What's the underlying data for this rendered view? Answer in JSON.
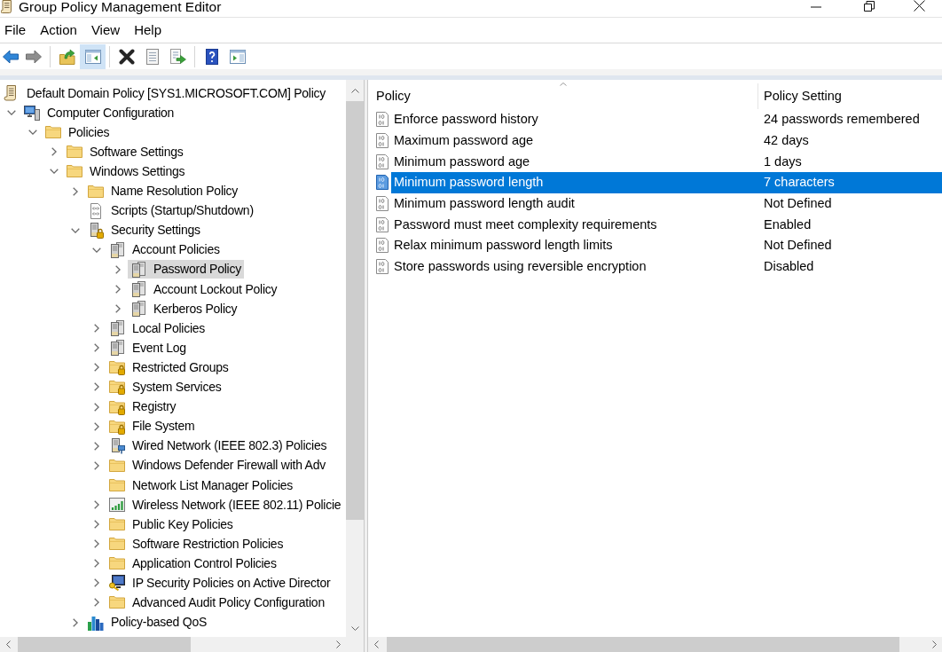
{
  "window": {
    "title": "Group Policy Management Editor"
  },
  "menu": [
    "File",
    "Action",
    "View",
    "Help"
  ],
  "toolbar": {
    "groups": [
      {
        "buttons": [
          {
            "kind": "back",
            "pressed": false,
            "disabled": false
          },
          {
            "kind": "forward",
            "pressed": false,
            "disabled": true
          }
        ]
      },
      {
        "buttons": [
          {
            "kind": "up",
            "pressed": false,
            "disabled": false
          },
          {
            "kind": "console_tree",
            "pressed": true,
            "disabled": false
          }
        ]
      },
      {
        "buttons": [
          {
            "kind": "delete",
            "pressed": false,
            "disabled": false
          },
          {
            "kind": "properties",
            "pressed": false,
            "disabled": false
          },
          {
            "kind": "export",
            "pressed": false,
            "disabled": false
          }
        ]
      },
      {
        "buttons": [
          {
            "kind": "help",
            "pressed": false,
            "disabled": false
          },
          {
            "kind": "action_pane",
            "pressed": false,
            "disabled": false
          }
        ]
      }
    ]
  },
  "tree": {
    "root": {
      "label": "Default Domain Policy [SYS1.MICROSOFT.COM] Policy",
      "kind": "policy",
      "selected": false,
      "children": [
        {
          "label": "Computer Configuration",
          "kind": "computer",
          "expandable": true,
          "expanded": true,
          "selected": false,
          "children": [
            {
              "label": "Policies",
              "kind": "folder",
              "expandable": true,
              "expanded": true,
              "selected": false,
              "children": [
                {
                  "label": "Software Settings",
                  "kind": "folder",
                  "expandable": true,
                  "expanded": false,
                  "selected": false
                },
                {
                  "label": "Windows Settings",
                  "kind": "folder",
                  "expandable": true,
                  "expanded": true,
                  "selected": false,
                  "children": [
                    {
                      "label": "Name Resolution Policy",
                      "kind": "folder",
                      "expandable": true,
                      "expanded": false,
                      "selected": false
                    },
                    {
                      "label": "Scripts (Startup/Shutdown)",
                      "kind": "script",
                      "expandable": false,
                      "selected": false
                    },
                    {
                      "label": "Security Settings",
                      "kind": "security",
                      "expandable": true,
                      "expanded": true,
                      "selected": false,
                      "children": [
                        {
                          "label": "Account Policies",
                          "kind": "server",
                          "expandable": true,
                          "expanded": true,
                          "selected": false,
                          "children": [
                            {
                              "label": "Password Policy",
                              "kind": "server",
                              "expandable": true,
                              "expanded": false,
                              "selected": true
                            },
                            {
                              "label": "Account Lockout Policy",
                              "kind": "server",
                              "expandable": true,
                              "expanded": false,
                              "selected": false
                            },
                            {
                              "label": "Kerberos Policy",
                              "kind": "server",
                              "expandable": true,
                              "expanded": false,
                              "selected": false
                            }
                          ]
                        },
                        {
                          "label": "Local Policies",
                          "kind": "server",
                          "expandable": true,
                          "expanded": false,
                          "selected": false
                        },
                        {
                          "label": "Event Log",
                          "kind": "server",
                          "expandable": true,
                          "expanded": false,
                          "selected": false
                        },
                        {
                          "label": "Restricted Groups",
                          "kind": "locked_folder",
                          "expandable": true,
                          "expanded": false,
                          "selected": false
                        },
                        {
                          "label": "System Services",
                          "kind": "locked_folder",
                          "expandable": true,
                          "expanded": false,
                          "selected": false
                        },
                        {
                          "label": "Registry",
                          "kind": "locked_folder",
                          "expandable": true,
                          "expanded": false,
                          "selected": false
                        },
                        {
                          "label": "File System",
                          "kind": "locked_folder",
                          "expandable": true,
                          "expanded": false,
                          "selected": false
                        },
                        {
                          "label": "Wired Network (IEEE 802.3) Policies",
                          "kind": "wired",
                          "expandable": true,
                          "expanded": false,
                          "selected": false
                        },
                        {
                          "label": "Windows Defender Firewall with Adv",
                          "kind": "folder",
                          "expandable": true,
                          "expanded": false,
                          "selected": false
                        },
                        {
                          "label": "Network List Manager Policies",
                          "kind": "folder",
                          "expandable": false,
                          "selected": false
                        },
                        {
                          "label": "Wireless Network (IEEE 802.11) Policie",
                          "kind": "wireless",
                          "expandable": true,
                          "expanded": false,
                          "selected": false
                        },
                        {
                          "label": "Public Key Policies",
                          "kind": "folder",
                          "expandable": true,
                          "expanded": false,
                          "selected": false
                        },
                        {
                          "label": "Software Restriction Policies",
                          "kind": "folder",
                          "expandable": true,
                          "expanded": false,
                          "selected": false
                        },
                        {
                          "label": "Application Control Policies",
                          "kind": "folder",
                          "expandable": true,
                          "expanded": false,
                          "selected": false
                        },
                        {
                          "label": "IP Security Policies on Active Director",
                          "kind": "ipsec",
                          "expandable": true,
                          "expanded": false,
                          "selected": false
                        },
                        {
                          "label": "Advanced Audit Policy Configuration",
                          "kind": "folder",
                          "expandable": true,
                          "expanded": false,
                          "selected": false
                        }
                      ]
                    },
                    {
                      "label": "Policy-based QoS",
                      "kind": "qos",
                      "expandable": true,
                      "expanded": false,
                      "selected": false
                    }
                  ]
                }
              ]
            }
          ]
        }
      ]
    }
  },
  "list": {
    "columns": [
      {
        "label": "Policy",
        "sorted": true
      },
      {
        "label": "Policy Setting",
        "sorted": false
      }
    ],
    "rows": [
      {
        "policy": "Enforce password history",
        "setting": "24 passwords remembered",
        "selected": false
      },
      {
        "policy": "Maximum password age",
        "setting": "42 days",
        "selected": false
      },
      {
        "policy": "Minimum password age",
        "setting": "1 days",
        "selected": false
      },
      {
        "policy": "Minimum password length",
        "setting": "7 characters",
        "selected": true
      },
      {
        "policy": "Minimum password length audit",
        "setting": "Not Defined",
        "selected": false
      },
      {
        "policy": "Password must meet complexity requirements",
        "setting": "Enabled",
        "selected": false
      },
      {
        "policy": "Relax minimum password length limits",
        "setting": "Not Defined",
        "selected": false
      },
      {
        "policy": "Store passwords using reversible encryption",
        "setting": "Disabled",
        "selected": false
      }
    ]
  }
}
